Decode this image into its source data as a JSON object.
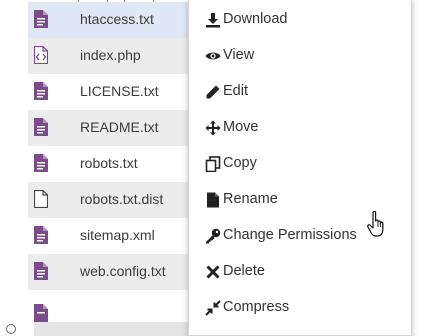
{
  "files": [
    {
      "name": "htaccess.txt",
      "icon": "text-file-icon",
      "shaded": false,
      "highlight": true
    },
    {
      "name": "index.php",
      "icon": "code-file-icon",
      "shaded": true
    },
    {
      "name": "LICENSE.txt",
      "icon": "text-file-icon",
      "shaded": false
    },
    {
      "name": "README.txt",
      "icon": "text-file-icon",
      "shaded": true
    },
    {
      "name": "robots.txt",
      "icon": "text-file-icon",
      "shaded": false
    },
    {
      "name": "robots.txt.dist",
      "icon": "blank-file-icon",
      "shaded": true
    },
    {
      "name": "sitemap.xml",
      "icon": "text-file-icon",
      "shaded": false
    },
    {
      "name": "web.config.txt",
      "icon": "text-file-icon",
      "shaded": true
    },
    {
      "name": "",
      "icon": "text-file-icon",
      "shaded": false
    }
  ],
  "context_menu": {
    "items": [
      {
        "label": "Download",
        "icon": "download-icon"
      },
      {
        "label": "View",
        "icon": "eye-icon"
      },
      {
        "label": "Edit",
        "icon": "pencil-icon"
      },
      {
        "label": "Move",
        "icon": "move-arrows-icon"
      },
      {
        "label": "Copy",
        "icon": "copy-icon"
      },
      {
        "label": "Rename",
        "icon": "rename-file-icon"
      },
      {
        "label": "Change Permissions",
        "icon": "key-icon"
      },
      {
        "label": "Delete",
        "icon": "x-icon"
      },
      {
        "label": "Compress",
        "icon": "compress-icon"
      }
    ]
  },
  "colors": {
    "file_icon": "#7b4b8c",
    "text": "#333333",
    "row_shade": "#ececec"
  }
}
